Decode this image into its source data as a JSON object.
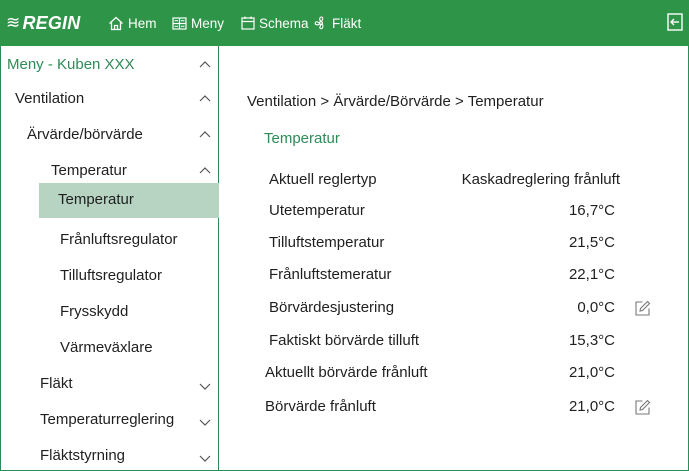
{
  "topbar": {
    "brand": "REGIN",
    "nav": [
      {
        "label": "Hem",
        "icon": "home-icon"
      },
      {
        "label": "Meny",
        "icon": "grid-icon"
      },
      {
        "label": "Schema",
        "icon": "calendar-icon"
      },
      {
        "label": "Fläkt",
        "icon": "fan-icon"
      }
    ],
    "logout_icon": "logout-icon"
  },
  "colors": {
    "brand_green": "#2e9447",
    "accent_green": "#2e8b57",
    "selected_bg": "#b7d4c2"
  },
  "sidebar": {
    "items": [
      {
        "label": "Meny - Kuben XXX",
        "chevron": "up"
      },
      {
        "label": "Ventilation",
        "chevron": "up"
      },
      {
        "label": "Ärvärde/börvärde",
        "chevron": "up"
      },
      {
        "label": "Temperatur",
        "chevron": "up"
      },
      {
        "label": "Temperatur",
        "chevron": "",
        "selected": true
      },
      {
        "label": "Frånluftsregulator",
        "chevron": ""
      },
      {
        "label": "Tilluftsregulator",
        "chevron": ""
      },
      {
        "label": "Frysskydd",
        "chevron": ""
      },
      {
        "label": "Värmeväxlare",
        "chevron": ""
      },
      {
        "label": "Fläkt",
        "chevron": "down"
      },
      {
        "label": "Temperaturreglering",
        "chevron": "down"
      },
      {
        "label": "Fläktstyrning",
        "chevron": "down"
      }
    ]
  },
  "main": {
    "breadcrumb": "Ventilation > Ärvärde/Börvärde > Temperatur",
    "section_title": "Temperatur",
    "rows": [
      {
        "label": "Aktuell reglertyp",
        "value": "Kaskadreglering frånluft",
        "editable": false
      },
      {
        "label": "Utetemperatur",
        "value": "16,7°C",
        "editable": false
      },
      {
        "label": "Tilluftstemperatur",
        "value": "21,5°C",
        "editable": false
      },
      {
        "label": "Frånluftstemeratur",
        "value": "22,1°C",
        "editable": false
      },
      {
        "label": "Börvärdesjustering",
        "value": "0,0°C",
        "editable": true
      },
      {
        "label": "Faktiskt börvärde tilluft",
        "value": "15,3°C",
        "editable": false
      },
      {
        "label": "Aktuellt börvärde frånluft",
        "value": "21,0°C",
        "editable": false
      },
      {
        "label": "Börvärde frånluft",
        "value": "21,0°C",
        "editable": true
      }
    ]
  }
}
